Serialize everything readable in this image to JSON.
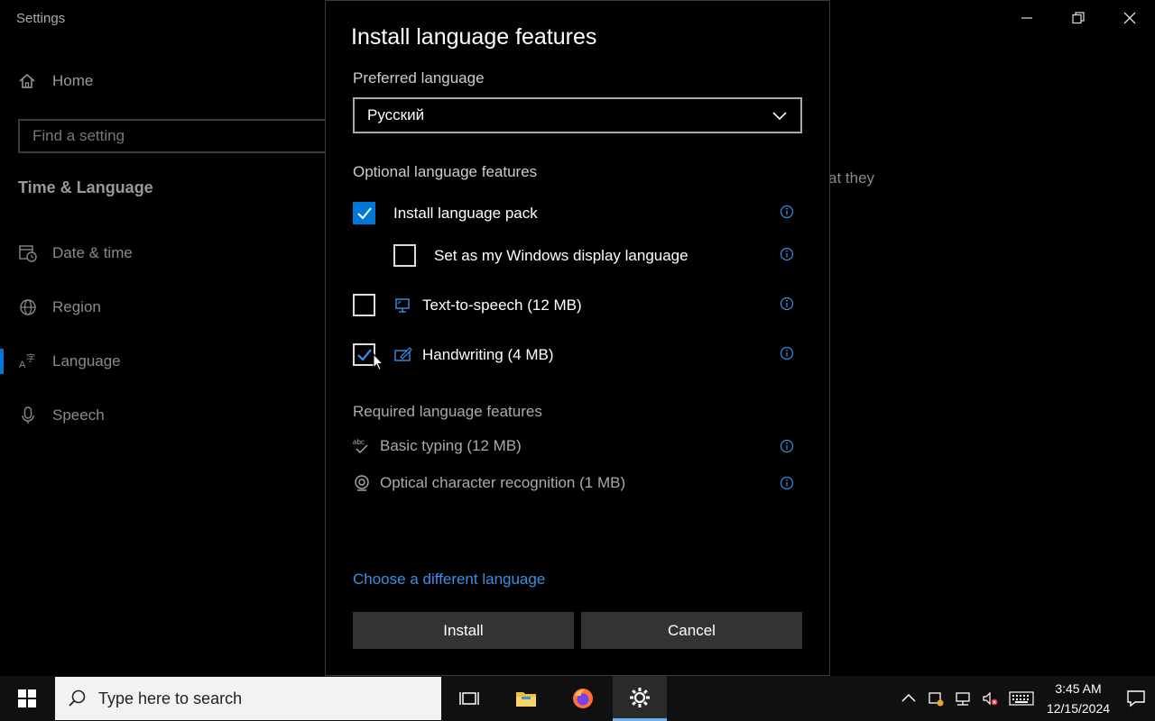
{
  "window": {
    "title": "Settings",
    "controls": {
      "minimize": "—",
      "restore": "❐",
      "close": "✕"
    }
  },
  "sidebar": {
    "home_label": "Home",
    "search_placeholder": "Find a setting",
    "section_title": "Time & Language",
    "items": [
      {
        "label": "Date & time",
        "icon": "calendar-clock-icon"
      },
      {
        "label": "Region",
        "icon": "globe-icon"
      },
      {
        "label": "Language",
        "icon": "language-icon",
        "active": true
      },
      {
        "label": "Speech",
        "icon": "microphone-icon"
      }
    ]
  },
  "background_text": "at they",
  "dialog": {
    "title": "Install language features",
    "preferred_label": "Preferred language",
    "selected_language": "Русский",
    "optional_label": "Optional language features",
    "options": [
      {
        "label": "Install language pack",
        "checked": true
      },
      {
        "label": "Set as my Windows display language",
        "checked": false
      },
      {
        "label": "Text-to-speech (12 MB)",
        "checked": false,
        "icon": "speech-icon"
      },
      {
        "label": "Handwriting (4 MB)",
        "checked": true,
        "icon": "handwriting-icon"
      }
    ],
    "required_label": "Required language features",
    "required": [
      {
        "label": "Basic typing (12 MB)",
        "icon": "abc-check-icon"
      },
      {
        "label": "Optical character recognition (1 MB)",
        "icon": "ocr-icon"
      }
    ],
    "change_link": "Choose a different language",
    "install_label": "Install",
    "cancel_label": "Cancel"
  },
  "taskbar": {
    "search_placeholder": "Type here to search",
    "time": "3:45 AM",
    "date": "12/15/2024"
  },
  "colors": {
    "accent": "#0078d7",
    "link": "#3a8ee6",
    "button_bg": "#333333"
  }
}
